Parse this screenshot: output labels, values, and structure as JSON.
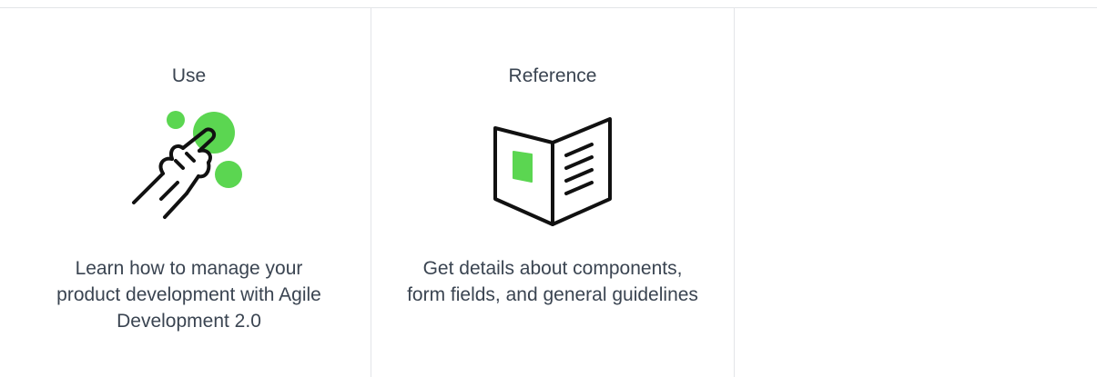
{
  "colors": {
    "accent": "#5bd651",
    "text": "#3a4451",
    "divider": "#e3e5e8",
    "icon_stroke": "#111111"
  },
  "cards": [
    {
      "title": "Use",
      "icon": "pointing-hand-icon",
      "description": "Learn how to manage your product development with Agile Development 2.0"
    },
    {
      "title": "Reference",
      "icon": "open-book-icon",
      "description": "Get details about components, form fields, and general guidelines"
    },
    {
      "title": "",
      "icon": "",
      "description": ""
    }
  ]
}
